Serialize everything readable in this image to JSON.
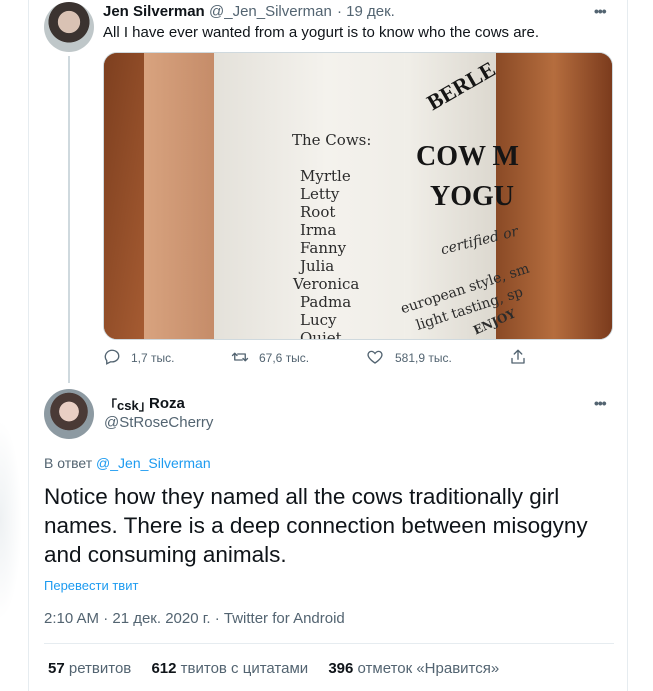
{
  "tweet1": {
    "name": "Jen Silverman",
    "handle": "@_Jen_Silverman",
    "date": "· 19 дек.",
    "text": "All I have ever wanted from a yogurt is to know who the cows are.",
    "image": {
      "cows_title": "The Cows:",
      "cow_names": [
        "Myrtle",
        "Letty",
        "Root",
        "Irma",
        "Fanny",
        "Julia",
        "Veronica",
        "Padma",
        "Lucy",
        "Quiet"
      ],
      "brand_top": "BERLE",
      "brand_cow": "COW M",
      "brand_yog": "YOGU",
      "certified": "certified or",
      "european": "european style, sm",
      "light": "light tasting, sp",
      "enjoy": "ENJOY"
    },
    "actions": {
      "replies": "1,7 тыс.",
      "retweets": "67,6 тыс.",
      "likes": "581,9 тыс."
    }
  },
  "tweet2": {
    "name_prefix": "「csk」",
    "name": "Roza",
    "handle": "@StRoseCherry",
    "reply_to_label": "В ответ",
    "reply_to_handle": "@_Jen_Silverman",
    "text": "Notice how they named all the cows traditionally girl names. There is a deep connection between misogyny and consuming animals.",
    "translate": "Перевести твит",
    "time": "2:10 AM · 21 дек. 2020 г. · Twitter for Android",
    "stats": {
      "retweets_count": "57",
      "retweets_label": "ретвитов",
      "quotes_count": "612",
      "quotes_label": "твитов с цитатами",
      "likes_count": "396",
      "likes_label": "отметок «Нравится»"
    }
  },
  "colors": {
    "accent": "#1d9bf0",
    "secondary_text": "#536471",
    "primary_text": "#0f1419",
    "divider": "#e6ecf0"
  }
}
